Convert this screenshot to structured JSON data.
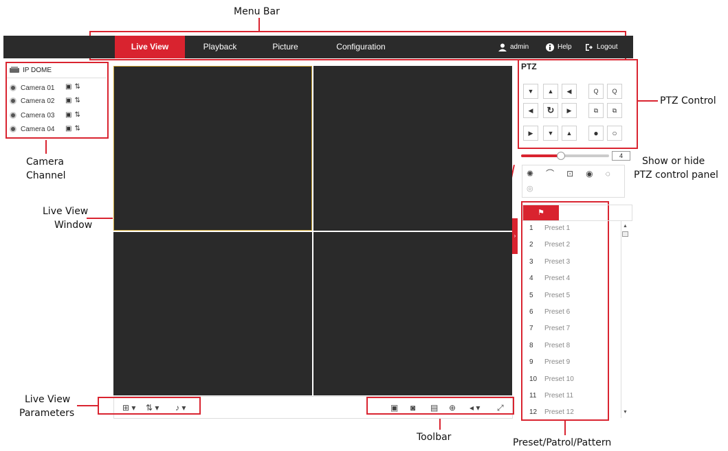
{
  "annotations": {
    "menu_bar": "Menu Bar",
    "ptz_control": "PTZ Control",
    "camera_channel_1": "Camera",
    "camera_channel_2": "Channel",
    "show_hide_1": "Show or hide",
    "show_hide_2": "PTZ control panel",
    "live_view_window_1": "Live View",
    "live_view_window_2": "Window",
    "live_view_params_1": "Live View",
    "live_view_params_2": "Parameters",
    "toolbar": "Toolbar",
    "preset_label": "Preset/Patrol/Pattern"
  },
  "nav": {
    "items": [
      {
        "label": "Live View",
        "active": true
      },
      {
        "label": "Playback",
        "active": false
      },
      {
        "label": "Picture",
        "active": false
      },
      {
        "label": "Configuration",
        "active": false
      }
    ],
    "user": "admin",
    "help": "Help",
    "logout": "Logout"
  },
  "camera_tree": {
    "device": "IP DOME",
    "cameras": [
      "Camera 01",
      "Camera 02",
      "Camera 03",
      "Camera 04"
    ]
  },
  "ptz": {
    "title": "PTZ",
    "speed_value": "4",
    "speed_level": 0.45
  },
  "presets": [
    {
      "num": "1",
      "name": "Preset 1"
    },
    {
      "num": "2",
      "name": "Preset 2"
    },
    {
      "num": "3",
      "name": "Preset 3"
    },
    {
      "num": "4",
      "name": "Preset 4"
    },
    {
      "num": "5",
      "name": "Preset 5"
    },
    {
      "num": "6",
      "name": "Preset 6"
    },
    {
      "num": "7",
      "name": "Preset 7"
    },
    {
      "num": "8",
      "name": "Preset 8"
    },
    {
      "num": "9",
      "name": "Preset 9"
    },
    {
      "num": "10",
      "name": "Preset 10"
    },
    {
      "num": "11",
      "name": "Preset 11"
    },
    {
      "num": "12",
      "name": "Preset 12"
    }
  ],
  "colors": {
    "accent": "#d9232f",
    "topbar": "#2b2b2b",
    "video": "#2a2a2a"
  }
}
